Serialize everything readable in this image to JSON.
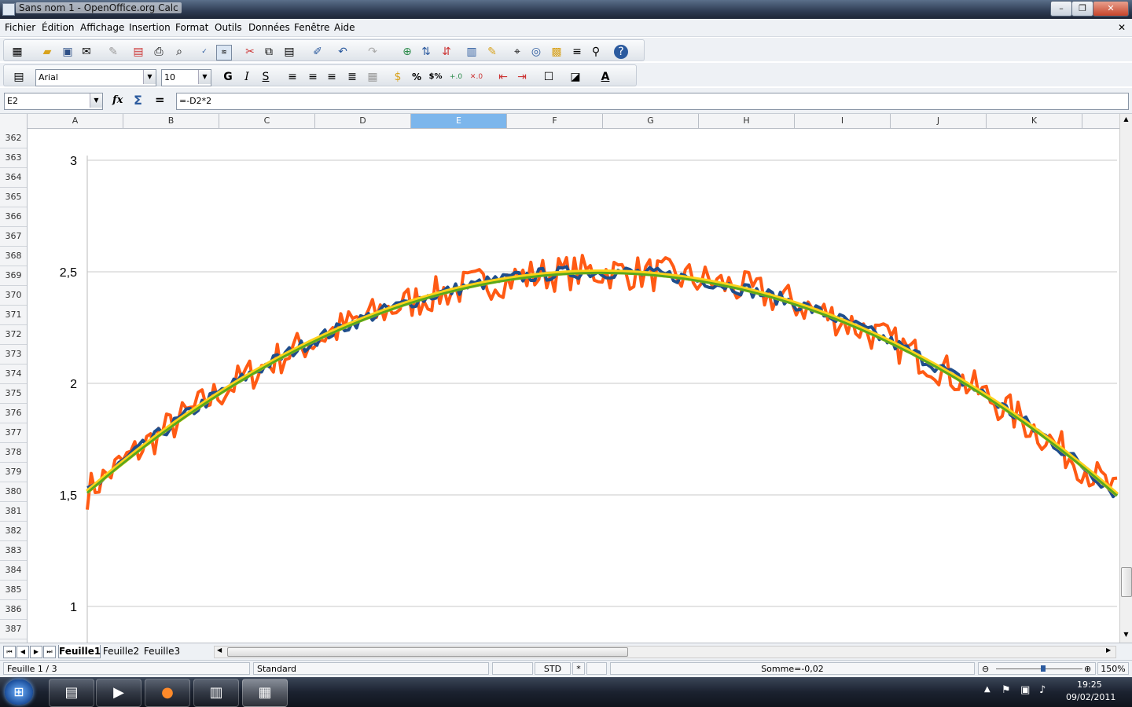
{
  "window": {
    "title": "Sans nom 1 - OpenOffice.org Calc",
    "minimize": "–",
    "maximize": "❐",
    "close": "✕"
  },
  "menu": {
    "items": [
      "Fichier",
      "Édition",
      "Affichage",
      "Insertion",
      "Format",
      "Outils",
      "Données",
      "Fenêtre",
      "Aide"
    ],
    "close": "✕"
  },
  "format_toolbar": {
    "font_name": "Arial",
    "font_size": "10",
    "bold": "G",
    "italic": "I",
    "underline": "S",
    "percent": "%",
    "currency": "$%"
  },
  "formula_bar": {
    "cell_ref": "E2",
    "formula": "=-D2*2",
    "fx": "fx",
    "sum": "Σ",
    "equals": "="
  },
  "columns": [
    "A",
    "B",
    "C",
    "D",
    "E",
    "F",
    "G",
    "H",
    "I",
    "J",
    "K"
  ],
  "selected_column": "E",
  "rows": [
    "362",
    "363",
    "364",
    "365",
    "366",
    "367",
    "368",
    "369",
    "370",
    "371",
    "372",
    "373",
    "374",
    "375",
    "376",
    "377",
    "378",
    "379",
    "380",
    "381",
    "382",
    "383",
    "384",
    "385",
    "386",
    "387"
  ],
  "sheet_tabs": [
    "Feuille1",
    "Feuille2",
    "Feuille3"
  ],
  "active_sheet": "Feuille1",
  "status": {
    "sheet": "Feuille 1 / 3",
    "page_style": "Standard",
    "mode": "STD",
    "modified": "*",
    "sum": "Somme=-0,02",
    "zoom": "150%"
  },
  "taskbar": {
    "time": "19:25",
    "date": "09/02/2011",
    "start_icon": "windows-orb",
    "apps": [
      "explorer-icon",
      "media-player-icon",
      "firefox-icon",
      "simcity-icon",
      "calc-icon"
    ]
  },
  "colors": {
    "series_blue": "#1f4e8c",
    "series_orange": "#ff5a14",
    "series_yellow": "#ffd21a",
    "series_green": "#5aa81c",
    "gridline": "#c8c8c8",
    "col_selected": "#7cb6ec"
  },
  "chart_data": {
    "type": "line",
    "y_ticks": [
      "1",
      "1,5",
      "2",
      "2,5",
      "3"
    ],
    "ylim": [
      0.85,
      3.0
    ],
    "x_range": [
      0,
      6.3
    ],
    "grid": true,
    "series": [
      {
        "color": "#ff5a14",
        "formula": "2.5 - (x-3.14)^2*0.1 + noise(±0.08)"
      },
      {
        "color": "#1f4e8c",
        "formula": "2.5 - (x-3.14)^2*0.1 + noise(±0.03)"
      },
      {
        "color": "#ffd21a",
        "formula": "smooth"
      },
      {
        "color": "#5aa81c",
        "formula": "smooth"
      }
    ]
  }
}
